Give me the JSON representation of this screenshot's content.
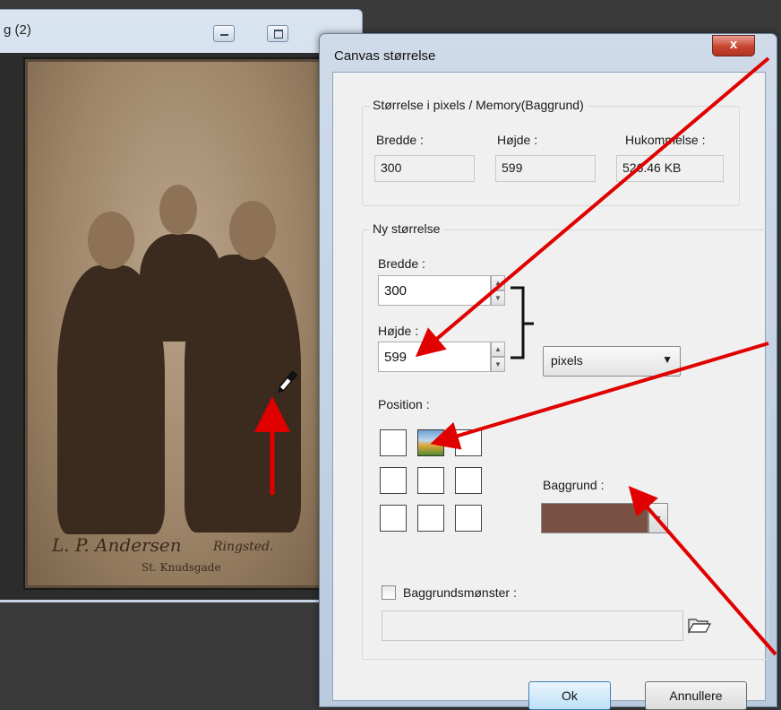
{
  "background_window": {
    "title": "g (2)"
  },
  "photo": {
    "caption_left": "L. P. Andersen",
    "caption_right": "Ringsted.",
    "caption_sub": "St. Knudsgade"
  },
  "dialog": {
    "title": "Canvas størrelse",
    "close_label": "x",
    "current_size": {
      "group_label": "Størrelse i pixels / Memory(Baggrund)",
      "width_label": "Bredde :",
      "width_value": "300",
      "height_label": "Højde :",
      "height_value": "599",
      "memory_label": "Hukommelse :",
      "memory_value": "526.46 KB"
    },
    "new_size": {
      "group_label": "Ny størrelse",
      "width_label": "Bredde :",
      "width_value": "300",
      "height_label": "Højde :",
      "height_value": "599",
      "unit_selected": "pixels",
      "position_label": "Position :",
      "selected_position": 1,
      "background_label": "Baggrund :",
      "background_color": "#7a5243",
      "pattern_checkbox_label": "Baggrundsmønster :",
      "pattern_checked": false,
      "pattern_value": ""
    },
    "buttons": {
      "ok": "Ok",
      "cancel": "Annullere"
    }
  },
  "colors": {
    "annotation_arrow": "#e00000",
    "dialog_frame": "#c2d1e3"
  }
}
